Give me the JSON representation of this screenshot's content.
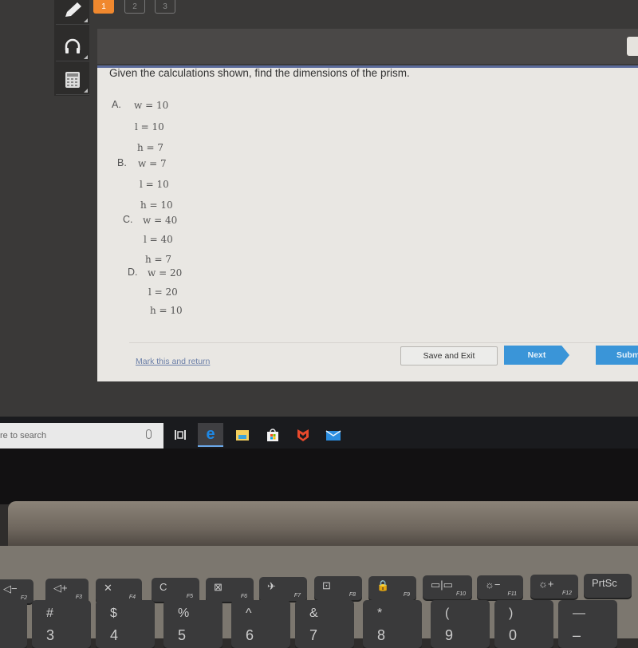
{
  "toolbar": {
    "tools": [
      {
        "name": "pencil",
        "icon": "pencil-icon"
      },
      {
        "name": "audio",
        "icon": "headphones-icon"
      },
      {
        "name": "calculator",
        "icon": "calculator-icon"
      }
    ]
  },
  "question_nav": {
    "items": [
      "1",
      "2",
      "3"
    ],
    "active_index": 0,
    "accent_color": "#f0882e"
  },
  "question": {
    "prompt": "Given the calculations shown, find the dimensions of the prism.",
    "options": [
      {
        "letter": "A.",
        "w": "w = 10",
        "l": "l = 10",
        "h": "h = 7"
      },
      {
        "letter": "B.",
        "w": "w = 7",
        "l": "l = 10",
        "h": "h = 10"
      },
      {
        "letter": "C.",
        "w": "w = 40",
        "l": "l = 40",
        "h": "h = 7"
      },
      {
        "letter": "D.",
        "w": "w = 20",
        "l": "l = 20",
        "h": "h = 10"
      }
    ]
  },
  "footer": {
    "mark_link": "Mark this and return",
    "save_exit": "Save and Exit",
    "next": "Next",
    "submit": "Subm",
    "button_color": "#3a95d8"
  },
  "taskbar": {
    "search_placeholder": "re to search",
    "icons": [
      "task-view-icon",
      "edge-icon",
      "file-explorer-icon",
      "store-icon",
      "mcafee-icon",
      "mail-icon"
    ]
  },
  "keyboard": {
    "fkeys": [
      {
        "glyph": "◁−",
        "label": "F2"
      },
      {
        "glyph": "◁+",
        "label": "F3"
      },
      {
        "glyph": "✕",
        "label": "F4"
      },
      {
        "glyph": "C",
        "label": "F5"
      },
      {
        "glyph": "⊠",
        "label": "F6"
      },
      {
        "glyph": "✈",
        "label": "F7"
      },
      {
        "glyph": "⊡",
        "label": "F8"
      },
      {
        "glyph": "🔒",
        "label": "F9"
      },
      {
        "glyph": "▭|▭",
        "label": "F10"
      },
      {
        "glyph": "☼−",
        "label": "F11"
      },
      {
        "glyph": "☼+",
        "label": "F12"
      },
      {
        "glyph": "PrtSc",
        "label": ""
      }
    ],
    "numkeys": [
      {
        "top": "@",
        "bot": ""
      },
      {
        "top": "#",
        "bot": "3"
      },
      {
        "top": "$",
        "bot": "4"
      },
      {
        "top": "%",
        "bot": "5"
      },
      {
        "top": "^",
        "bot": "6"
      },
      {
        "top": "&",
        "bot": "7"
      },
      {
        "top": "*",
        "bot": "8"
      },
      {
        "top": "(",
        "bot": "9"
      },
      {
        "top": ")",
        "bot": "0"
      },
      {
        "top": "—",
        "bot": "–"
      }
    ]
  }
}
